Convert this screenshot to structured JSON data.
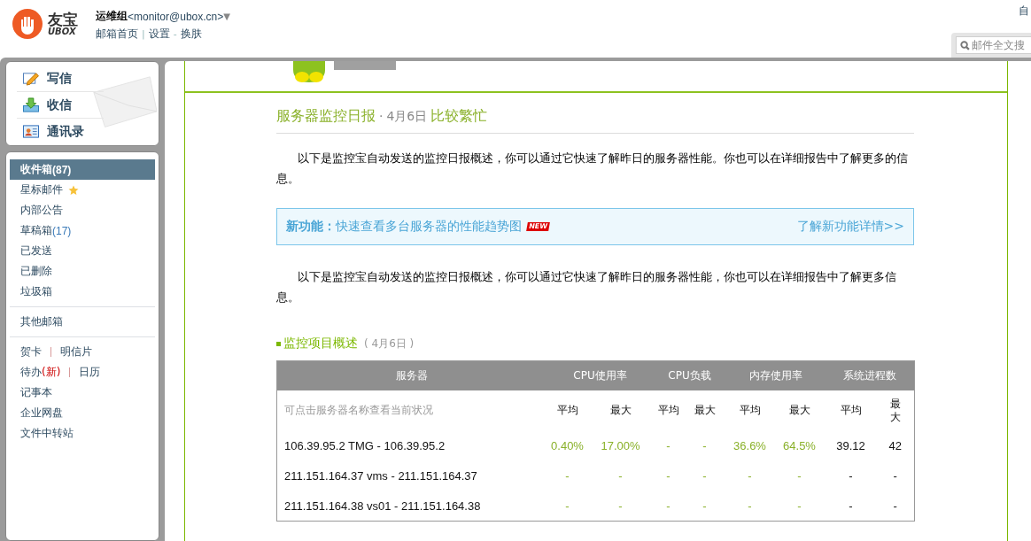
{
  "header": {
    "account_name": "运维组",
    "account_email": "<monitor@ubox.cn>",
    "menu_caret": "▼",
    "links": [
      {
        "label": "邮箱首页"
      },
      {
        "label": "设置",
        "separator": "|"
      },
      {
        "label": "换肤",
        "separator": "-"
      }
    ],
    "corner_text": "自",
    "search": {
      "placeholder": "邮件全文搜"
    }
  },
  "logo": {
    "name": "友宝",
    "sub": "UBOX"
  },
  "actions": [
    {
      "label": "写信",
      "kind": "compose"
    },
    {
      "label": "收信",
      "kind": "receive"
    },
    {
      "label": "通讯录",
      "kind": "contacts"
    }
  ],
  "folders": [
    {
      "label": "收件箱",
      "count": "(87)",
      "kind": "plain",
      "selected": true
    },
    {
      "label": "星标邮件",
      "kind": "star",
      "selected": false
    },
    {
      "label": "内部公告",
      "kind": "plain",
      "selected": false
    },
    {
      "label": "草稿箱",
      "count": "(17)",
      "kind": "plain",
      "selected": false
    },
    {
      "label": "已发送",
      "kind": "plain",
      "selected": false
    },
    {
      "label": "已删除",
      "kind": "plain",
      "selected": false
    },
    {
      "label": "垃圾箱",
      "kind": "plain",
      "selected": false
    }
  ],
  "other_mailbox": "其他邮箱",
  "tools": [
    {
      "links": [
        {
          "label": "贺卡"
        },
        {
          "label": "明信片"
        }
      ]
    },
    {
      "links": [
        {
          "label": "待办",
          "note": "(新)"
        },
        {
          "label": "日历"
        }
      ]
    },
    {
      "links": [
        {
          "label": "记事本"
        }
      ]
    },
    {
      "links": [
        {
          "label": "企业网盘"
        }
      ]
    },
    {
      "links": [
        {
          "label": "文件中转站"
        }
      ]
    }
  ],
  "report": {
    "title": "服务器监控日报",
    "dot": "·",
    "date": "4月6日",
    "status": "比较繁忙",
    "intro": "以下是监控宝自动发送的监控日报概述，你可以通过它快速了解昨日的服务器性能。你也可以在详细报告中了解更多的信息。",
    "banner": {
      "label": "新功能：",
      "text": "快速查看多台服务器的性能趋势图",
      "badge": "NEW",
      "link": "了解新功能详情>>"
    },
    "intro2": "以下是监控宝自动发送的监控日报概述，你可以通过它快速了解昨日的服务器性能，你也可以在详细报告中了解更多信息。",
    "section": {
      "title": "监控项目概述",
      "date": "( 4月6日 )"
    },
    "table": {
      "groups": [
        "服务器",
        "CPU使用率",
        "CPU负载",
        "内存使用率",
        "系统进程数"
      ],
      "hint": "可点击服务器名称查看当前状况",
      "subheaders": [
        "平均",
        "最大",
        "平均",
        "最大",
        "平均",
        "最大",
        "平均",
        "最大"
      ],
      "rows": [
        {
          "server": "106.39.95.2 TMG - 106.39.95.2",
          "values": [
            "0.40%",
            "17.00%",
            "-",
            "-",
            "36.6%",
            "64.5%",
            "39.12",
            "42"
          ]
        },
        {
          "server": "211.151.164.37 vms - 211.151.164.37",
          "values": [
            "-",
            "-",
            "-",
            "-",
            "-",
            "-",
            "-",
            "-"
          ]
        },
        {
          "server": "211.151.164.38 vs01 - 211.151.164.38",
          "values": [
            "-",
            "-",
            "-",
            "-",
            "-",
            "-",
            "-",
            "-"
          ]
        }
      ]
    }
  }
}
